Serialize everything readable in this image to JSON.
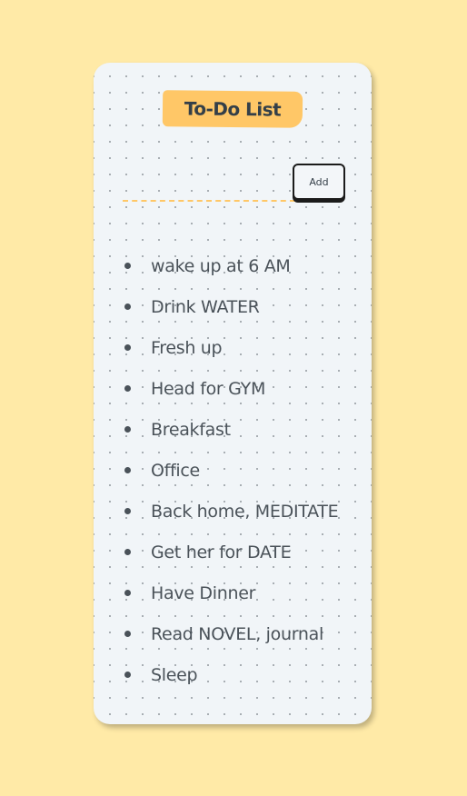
{
  "app": {
    "title": "To-Do List",
    "add_label": "Add",
    "input_value": "",
    "input_placeholder": ""
  },
  "tasks": [
    "wake up at 6 AM",
    "Drink WATER",
    "Fresh up",
    "Head for GYM",
    "Breakfast",
    "Office",
    "Back home, MEDITATE",
    "Get her for DATE",
    "Have Dinner",
    "Read NOVEL, journal",
    "Sleep"
  ],
  "colors": {
    "page_background": "#ffeaa7",
    "card_background": "#f1f5f8",
    "accent": "#ffc767",
    "text": "#343f48"
  }
}
